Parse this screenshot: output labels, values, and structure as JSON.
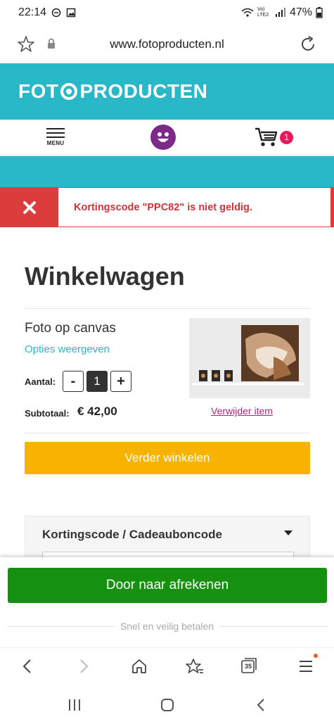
{
  "status_bar": {
    "time": "22:14",
    "lte_label": "Vo) LTE2",
    "battery": "47%"
  },
  "browser": {
    "url": "www.fotoproducten.nl"
  },
  "site": {
    "logo_left": "FOT",
    "logo_right": "PRODUCTEN",
    "menu_label": "MENU",
    "cart_count": "1",
    "brand_color": "#29b8c8"
  },
  "alert": {
    "message": "Kortingscode \"PPC82\" is niet geldig.",
    "color": "#dd3c3c"
  },
  "cart": {
    "title": "Winkelwagen",
    "item": {
      "name": "Foto op canvas",
      "options_link": "Opties weergeven",
      "quantity_label": "Aantal:",
      "quantity": "1",
      "minus": "-",
      "plus": "+",
      "subtotal_label": "Subtotaal:",
      "subtotal": "€ 42,00",
      "remove_link": "Verwijder item"
    },
    "continue_button": "Verder winkelen",
    "coupon_title": "Kortingscode / Cadeauboncode"
  },
  "checkout": {
    "button": "Door naar afrekenen",
    "secure_text": "Snel en veilig betalen"
  },
  "toolbar": {
    "tabs_count": "35"
  }
}
